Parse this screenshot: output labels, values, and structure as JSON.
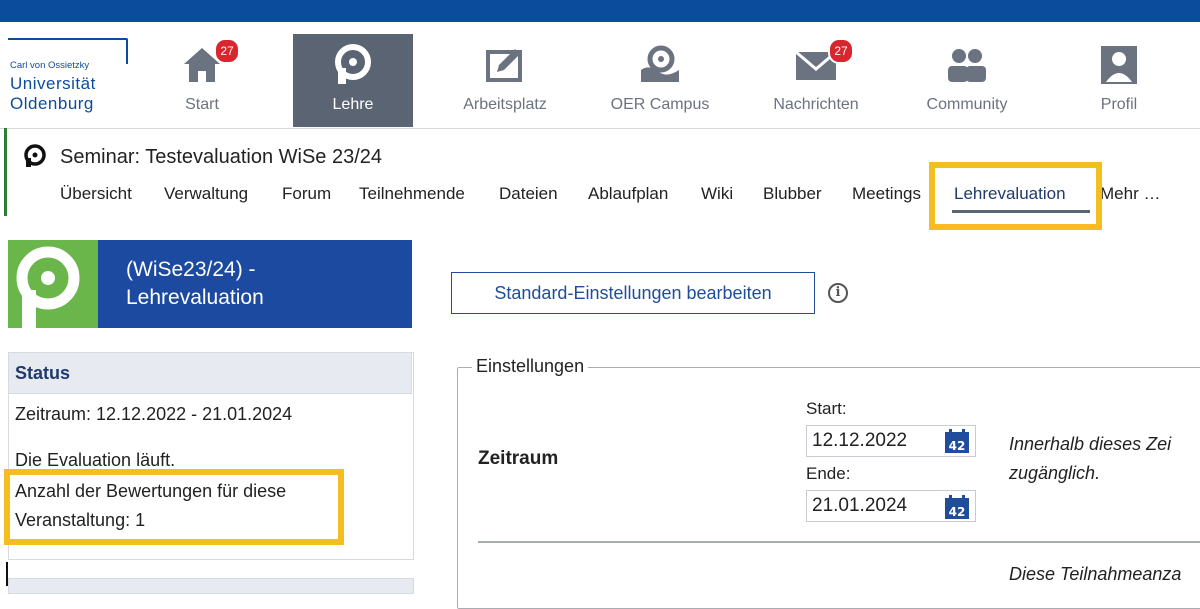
{
  "logo": {
    "line1": "Carl von Ossietzky",
    "line2": "Universität",
    "line3": "Oldenburg"
  },
  "nav": {
    "items": [
      {
        "label": "Start",
        "icon": "home-icon",
        "badge": "27"
      },
      {
        "label": "Lehre",
        "icon": "lehre-icon"
      },
      {
        "label": "Arbeitsplatz",
        "icon": "workplace-icon"
      },
      {
        "label": "OER Campus",
        "icon": "oer-campus-icon"
      },
      {
        "label": "Nachrichten",
        "icon": "mail-icon",
        "badge": "27"
      },
      {
        "label": "Community",
        "icon": "community-icon"
      },
      {
        "label": "Profil",
        "icon": "profile-icon"
      }
    ]
  },
  "course": {
    "title": "Seminar: Testevaluation WiSe 23/24",
    "tabs": [
      "Übersicht",
      "Verwaltung",
      "Forum",
      "Teilnehmende",
      "Dateien",
      "Ablaufplan",
      "Wiki",
      "Blubber",
      "Meetings",
      "Lehrevaluation",
      "Mehr …"
    ]
  },
  "sidebar": {
    "title_line1": "(WiSe23/24) -",
    "title_line2": "Lehrevaluation",
    "status_title": "Status",
    "zeitraum": "Zeitraum: 12.12.2022 - 21.01.2024",
    "running": "Die Evaluation läuft.",
    "count_line1": "Anzahl der Bewertungen für diese",
    "count_line2": "Veranstaltung: 1"
  },
  "main": {
    "std_button": "Standard-Einstellungen bearbeiten",
    "info_glyph": "i",
    "fieldset_legend": "Einstellungen",
    "zeitraum_label": "Zeitraum",
    "start_label": "Start:",
    "start_value": "12.12.2022",
    "end_label": "Ende:",
    "end_value": "21.01.2024",
    "calendar_day": "42",
    "hint_line1": "Innerhalb dieses Zei",
    "hint_line2": "zugänglich.",
    "hint_bottom": "Diese Teilnahmeanza"
  },
  "colors": {
    "topbar": "#0b4d9c",
    "active_nav": "#5b6472",
    "highlight": "#f5bd1f",
    "sidebar_blue": "#1c4aa0",
    "sidebar_green": "#6ab64a",
    "badge": "#d7262e"
  }
}
